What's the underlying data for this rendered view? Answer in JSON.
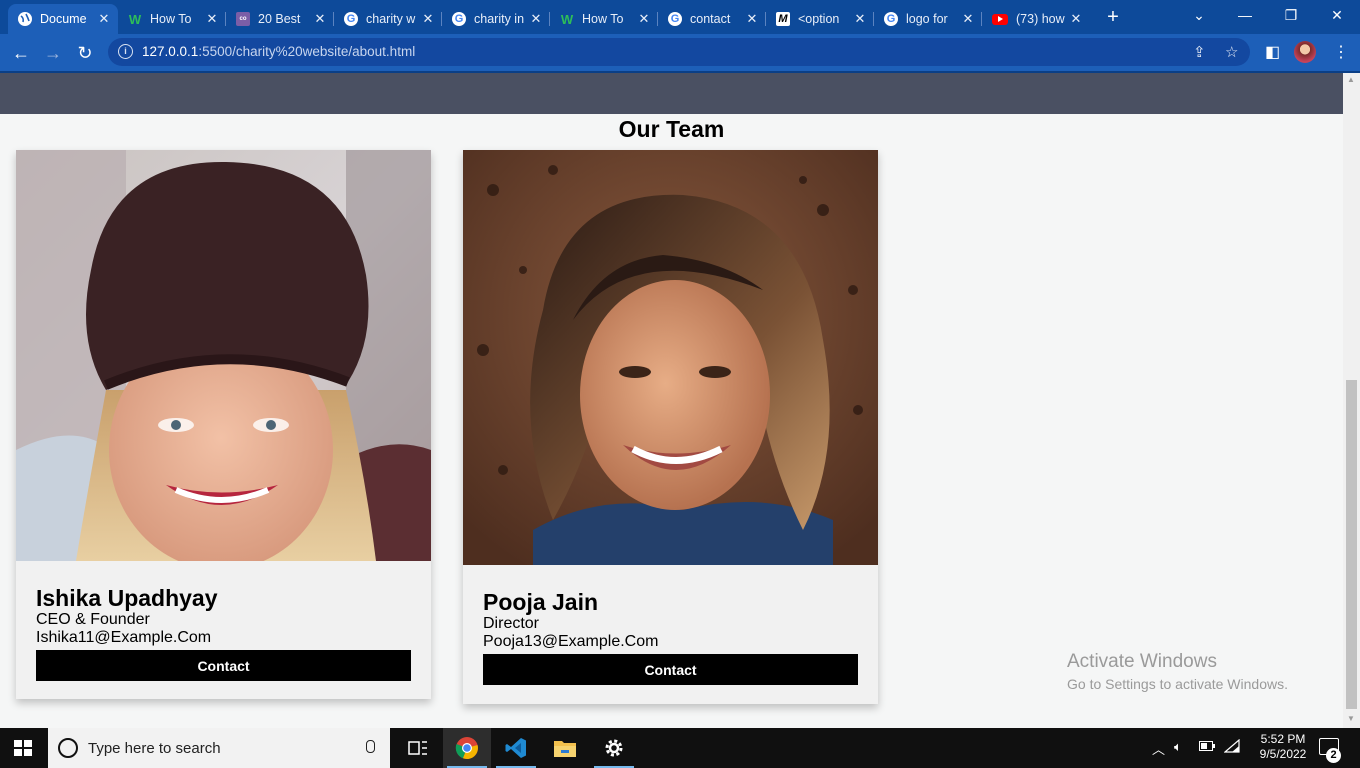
{
  "browser": {
    "tabs": [
      {
        "title": "Docume",
        "favicon": "globe-icon",
        "active": true
      },
      {
        "title": "How To",
        "favicon": "w-icon"
      },
      {
        "title": "20 Best",
        "favicon": "coolors-icon"
      },
      {
        "title": "charity w",
        "favicon": "google-icon"
      },
      {
        "title": "charity in",
        "favicon": "google-icon"
      },
      {
        "title": "How To",
        "favicon": "w-icon"
      },
      {
        "title": "contact",
        "favicon": "google-icon"
      },
      {
        "title": "<option",
        "favicon": "m-icon"
      },
      {
        "title": "logo for",
        "favicon": "google-icon"
      },
      {
        "title": "(73) how",
        "favicon": "youtube-icon"
      }
    ],
    "url_host": "127.0.0.1",
    "url_rest": ":5500/charity%20website/about.html"
  },
  "page": {
    "section_title": "Our Team",
    "members": [
      {
        "name": "Ishika Upadhyay",
        "role": "CEO & Founder",
        "email": "Ishika11@Example.Com",
        "button": "Contact"
      },
      {
        "name": "Pooja Jain",
        "role": "Director",
        "email": "Pooja13@Example.Com",
        "button": "Contact"
      }
    ]
  },
  "watermark": {
    "line1": "Activate Windows",
    "line2": "Go to Settings to activate Windows."
  },
  "taskbar": {
    "search_placeholder": "Type here to search",
    "time": "5:52 PM",
    "date": "9/5/2022",
    "notification_count": "2"
  },
  "colors": {
    "browser_frame": "#0d4a9a",
    "toolbar": "#1d5fb8",
    "page_nav_band": "#4a5062",
    "page_background": "#f5f6f6",
    "card_background": "#f1f1f1",
    "button_black": "#000000"
  }
}
